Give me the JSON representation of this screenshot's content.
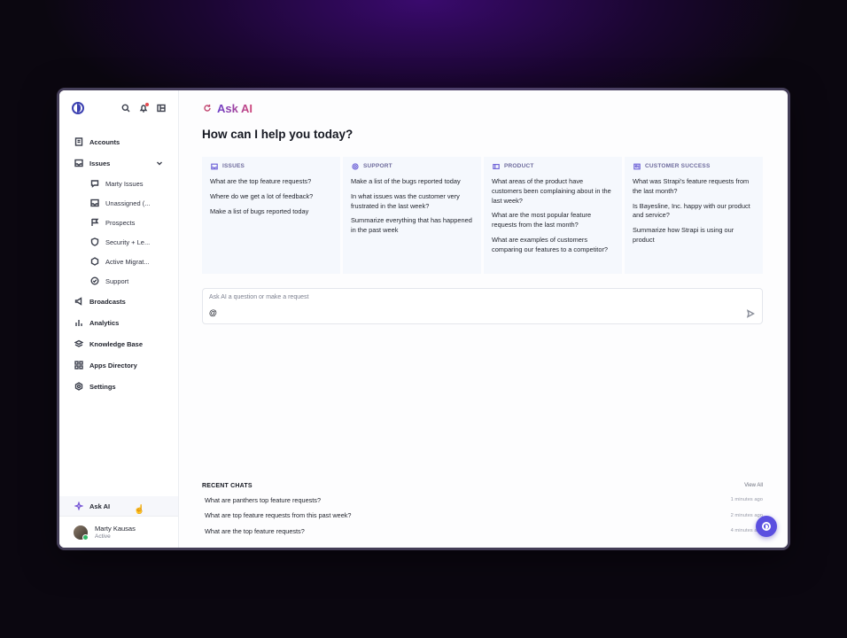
{
  "sidebar": {
    "nav": [
      {
        "label": "Accounts",
        "icon": "accounts-icon"
      },
      {
        "label": "Issues",
        "icon": "issues-icon"
      }
    ],
    "issues_sub": [
      {
        "label": "Marty Issues",
        "icon": "chat-icon"
      },
      {
        "label": "Unassigned (...",
        "icon": "inbox-icon"
      },
      {
        "label": "Prospects",
        "icon": "flag-icon"
      },
      {
        "label": "Security + Le...",
        "icon": "shield-icon"
      },
      {
        "label": "Active Migrat...",
        "icon": "hexagon-icon"
      },
      {
        "label": "Support",
        "icon": "check-circle-icon"
      }
    ],
    "nav_bottom": [
      {
        "label": "Broadcasts",
        "icon": "megaphone-icon"
      },
      {
        "label": "Analytics",
        "icon": "bar-chart-icon"
      },
      {
        "label": "Knowledge Base",
        "icon": "book-icon"
      },
      {
        "label": "Apps Directory",
        "icon": "grid-icon"
      },
      {
        "label": "Settings",
        "icon": "gear-icon"
      }
    ],
    "ask_ai": "Ask AI",
    "user": {
      "name": "Marty Kausas",
      "status": "Active"
    }
  },
  "main": {
    "title": "Ask AI",
    "heading": "How can I help you today?",
    "cards": [
      {
        "header": "ISSUES",
        "icon": "inbox-icon",
        "questions": [
          "What are the top feature requests?",
          "Where do we get a lot of feedback?",
          "Make a list of bugs reported today"
        ]
      },
      {
        "header": "SUPPORT",
        "icon": "lifebuoy-icon",
        "questions": [
          "Make a list of the bugs reported today",
          "In what issues was the customer very frustrated in the last week?",
          "Summarize everything that has happened in the past week"
        ]
      },
      {
        "header": "PRODUCT",
        "icon": "product-icon",
        "questions": [
          "What areas of the product have customers been complaining about in the last week?",
          "What are the most popular feature requests from the last month?",
          "What are examples of customers comparing our features to a competitor?"
        ]
      },
      {
        "header": "CUSTOMER SUCCESS",
        "icon": "users-icon",
        "questions": [
          "What was Strapi's feature requests from the last month?",
          "Is Bayesline, Inc. happy with our product and service?",
          "Summarize how Strapi is using our product"
        ]
      }
    ],
    "input": {
      "placeholder": "Ask AI a question or make a request",
      "value": "@"
    },
    "recent": {
      "title": "RECENT CHATS",
      "view_all": "View All",
      "chats": [
        {
          "q": "What are panthers top feature requests?",
          "t": "1 minutes ago"
        },
        {
          "q": "What are top feature requests from this past week?",
          "t": "2 minutes ago"
        },
        {
          "q": "What are the top feature requests?",
          "t": "4 minutes ago"
        }
      ]
    }
  }
}
